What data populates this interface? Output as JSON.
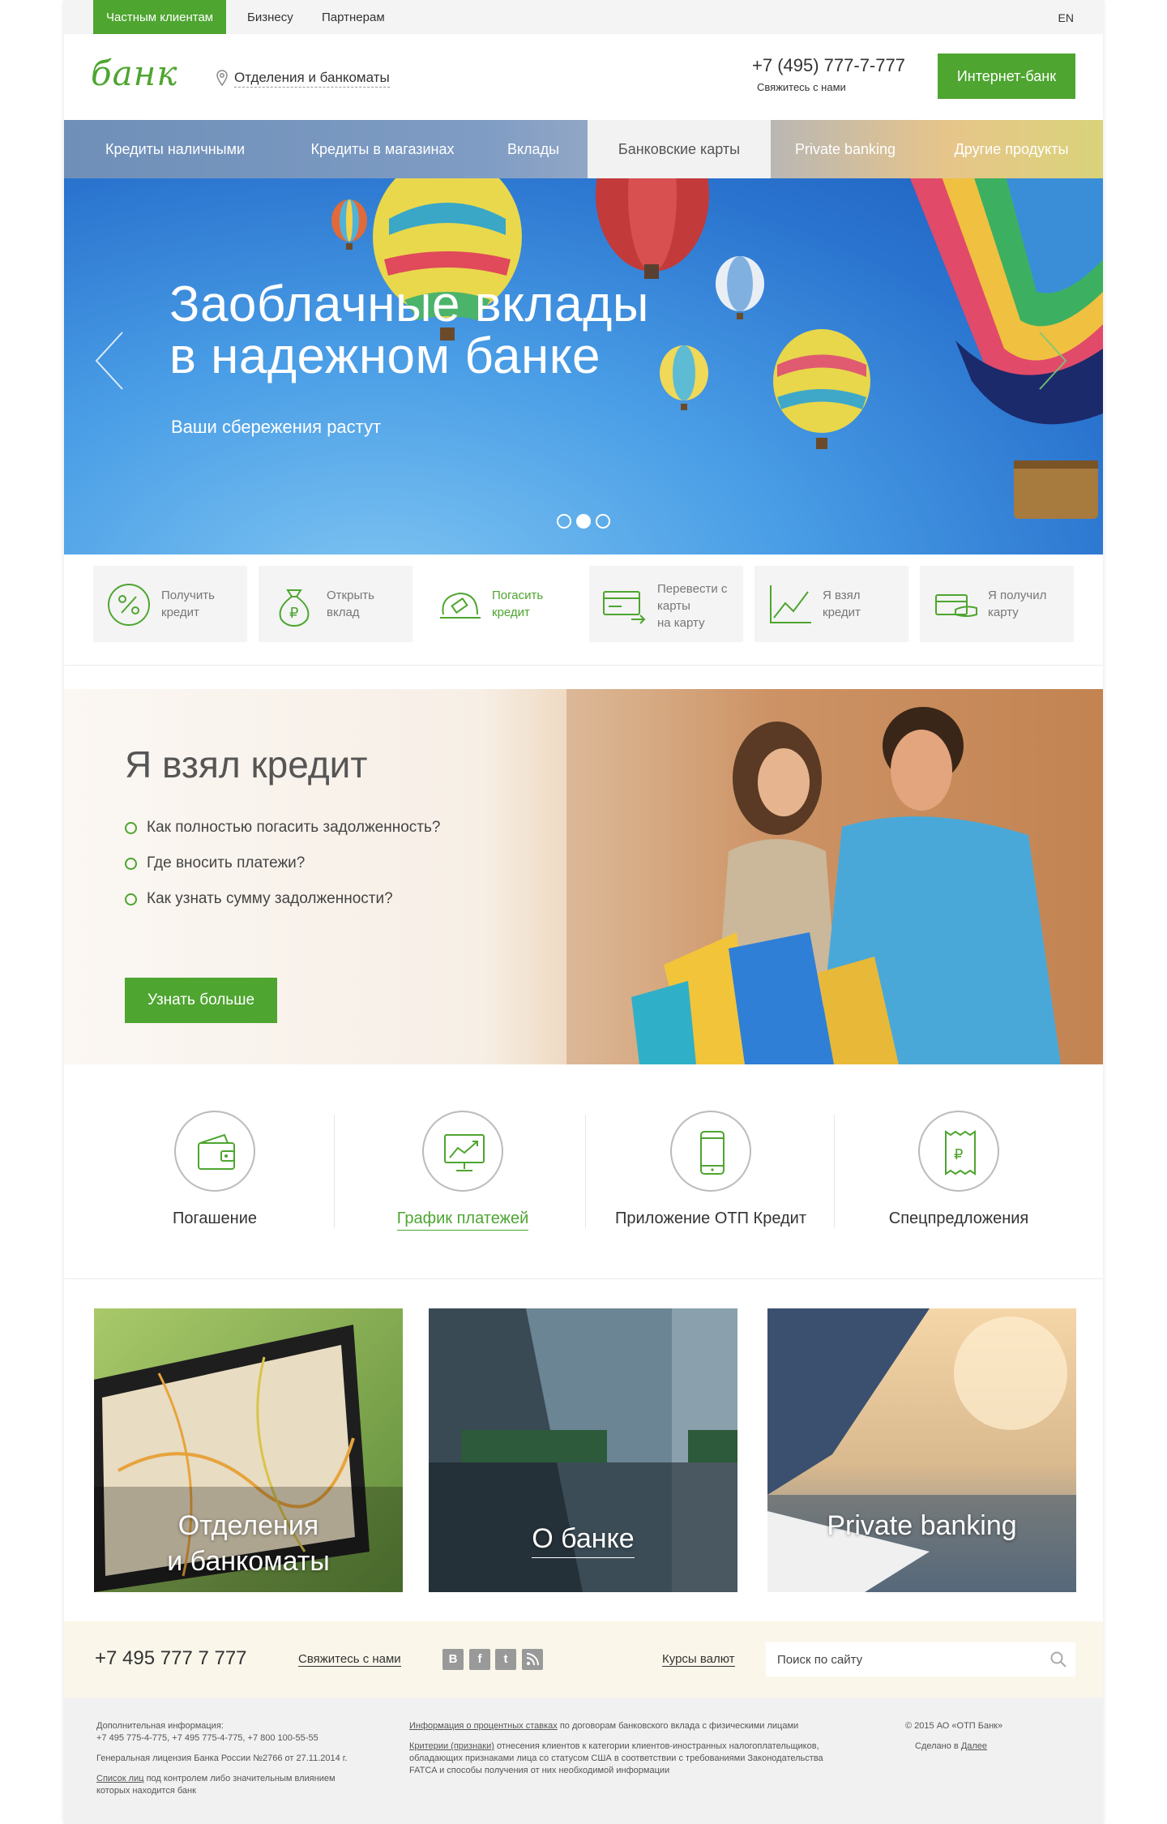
{
  "topbar": {
    "segments": [
      "Частным клиентам",
      "Бизнесу",
      "Партнерам"
    ],
    "lang": "EN"
  },
  "header": {
    "logo": "банк",
    "branches_link": "Отделения и банкоматы",
    "phone": "+7 (495) 777-7-777",
    "contact_link": "Свяжитесь с нами",
    "internet_bank_button": "Интернет-банк"
  },
  "nav": {
    "items": [
      "Кредиты наличными",
      "Кредиты в магазинах",
      "Вклады",
      "Банковские карты",
      "Private banking",
      "Другие продукты"
    ],
    "active_index": 3
  },
  "hero": {
    "title_line1": "Заоблачные вклады",
    "title_line2": "в надежном банке",
    "subtitle": "Ваши сбережения растут",
    "slides": 3,
    "active_slide": 2
  },
  "quick_actions": [
    {
      "line1": "Получить",
      "line2": "кредит",
      "icon": "percent-icon"
    },
    {
      "line1": "Открыть",
      "line2": "вклад",
      "icon": "money-bag-icon"
    },
    {
      "line1": "Погасить",
      "line2": "кредит",
      "icon": "payment-hand-icon"
    },
    {
      "line1": "Перевести с",
      "line2": "карты",
      "line3": "на карту",
      "icon": "card-transfer-icon"
    },
    {
      "line1": "Я взял",
      "line2": "кредит",
      "icon": "chart-up-icon"
    },
    {
      "line1": "Я получил",
      "line2": "карту",
      "icon": "card-hand-icon"
    }
  ],
  "promo": {
    "title": "Я взял кредит",
    "items": [
      "Как полностью погасить задолженность?",
      "Где вносить платежи?",
      "Как узнать сумму задолженности?"
    ],
    "button": "Узнать больше"
  },
  "services": [
    {
      "label": "Погашение",
      "icon": "wallet-icon"
    },
    {
      "label": "График платежей",
      "icon": "monitor-chart-icon"
    },
    {
      "label": "Приложение ОТП Кредит",
      "icon": "smartphone-icon"
    },
    {
      "label": "Спецпредложения",
      "icon": "receipt-icon"
    }
  ],
  "tiles": [
    {
      "line1": "Отделения",
      "line2": "и банкоматы"
    },
    {
      "line1": "О банке"
    },
    {
      "line1": "Private banking"
    }
  ],
  "footer": {
    "phone": "+7 495 777 7 777",
    "contact": "Свяжитесь с нами",
    "social": [
      "В",
      "f",
      "t",
      "rss"
    ],
    "rates": "Курсы валют",
    "search_placeholder": "Поиск по сайту",
    "info_title": "Дополнительная информация:",
    "info_phones": "+7 495 775-4-775, +7 495 775-4-775, +7 800 100-55-55",
    "license": "Генеральная лицензия Банка России №2766 от 27.11.2014 г.",
    "control_link": "Список лиц",
    "control_text_1": " под контролем либо значительным влиянием",
    "control_text_2": "которых находится банк",
    "rates_info_link": "Информация о процентных ставках",
    "rates_info_text": " по договорам банковского вклада с физическими лицами",
    "fatca_link": "Критерии (признаки)",
    "fatca_text_1": " отнесения клиентов к категории клиентов-иностранных налогоплательщиков,",
    "fatca_text_2": "обладающих признаками лица со статусом США в соответствии с требованиями Законодательства",
    "fatca_text_3": "FATCA и способы получения от них необходимой информации",
    "copyright": "© 2015 АО «ОТП Банк»",
    "made_by": "Сделано в ",
    "made_by_link": "Далее"
  },
  "colors": {
    "accent": "#4ea530",
    "nav_bg": "#7e9cc4",
    "footer_band": "#faf7ea",
    "footer_bottom": "#f1f1f1"
  }
}
